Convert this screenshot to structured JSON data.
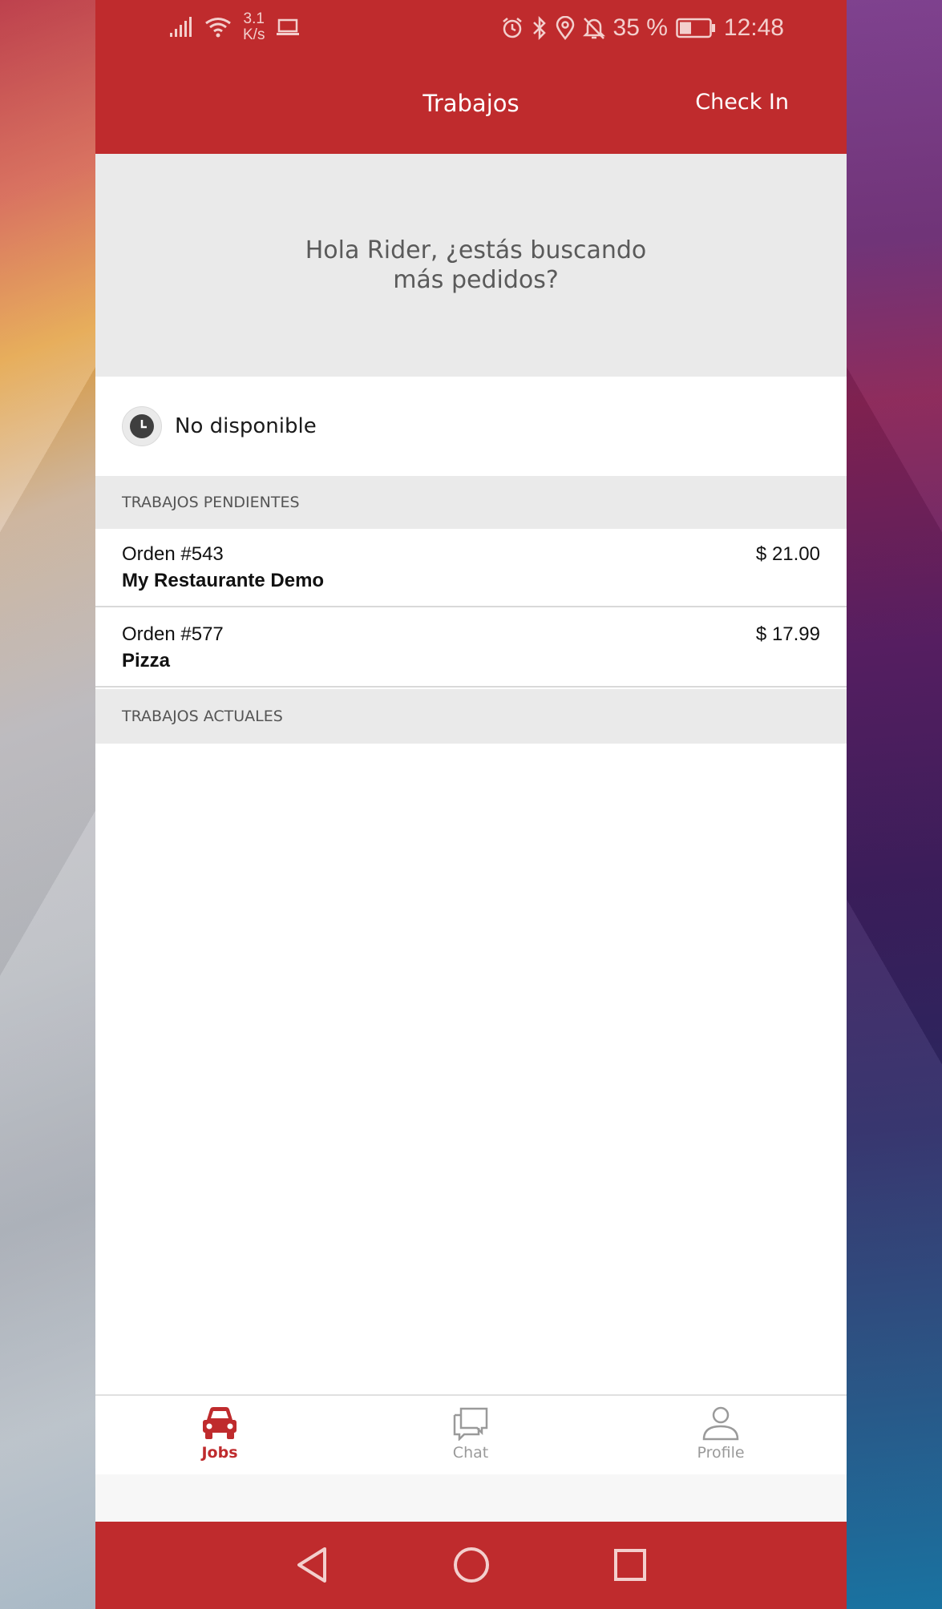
{
  "status_bar": {
    "net_speed_value": "3.1",
    "net_speed_unit": "K/s",
    "battery_percent": "35 %",
    "time": "12:48"
  },
  "app_bar": {
    "title": "Trabajos",
    "check_in_label": "Check In"
  },
  "banner": {
    "greeting": "Hola Rider, ¿estás buscando más pedidos?"
  },
  "availability": {
    "label": "No disponible",
    "icon": "clock-icon"
  },
  "pending": {
    "header": "TRABAJOS PENDIENTES",
    "orders": [
      {
        "number": "Orden #543",
        "restaurant": "My Restaurante Demo",
        "price": "$ 21.00"
      },
      {
        "number": "Orden #577",
        "restaurant": "Pizza",
        "price": "$ 17.99"
      }
    ]
  },
  "current": {
    "header": "TRABAJOS ACTUALES"
  },
  "tabs": [
    {
      "label": "Jobs",
      "icon": "car-icon",
      "active": true
    },
    {
      "label": "Chat",
      "icon": "chat-icon",
      "active": false
    },
    {
      "label": "Profile",
      "icon": "person-icon",
      "active": false
    }
  ],
  "colors": {
    "brand_red": "#bf2b2d",
    "section_gray": "#eaeaea",
    "inactive_tab": "#9a9a9a"
  }
}
